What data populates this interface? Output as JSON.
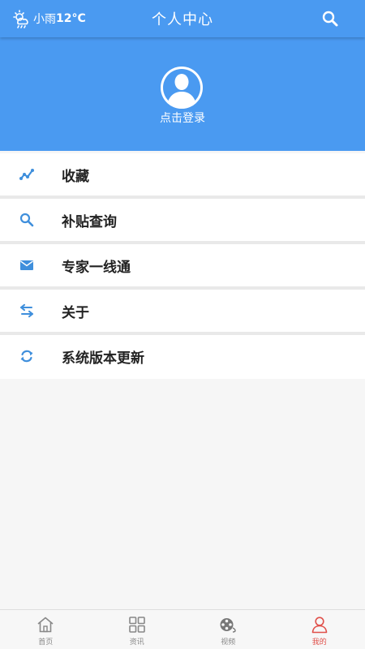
{
  "header": {
    "weather": {
      "condition": "小雨",
      "temperature": "12°C"
    },
    "title": "个人中心",
    "login_text": "点击登录"
  },
  "menu": {
    "items": [
      {
        "label": "收藏",
        "icon": "trend-icon"
      },
      {
        "label": "补贴查询",
        "icon": "search-icon"
      },
      {
        "label": "专家一线通",
        "icon": "mail-icon"
      },
      {
        "label": "关于",
        "icon": "swap-arrows-icon"
      },
      {
        "label": "系统版本更新",
        "icon": "refresh-icon"
      }
    ]
  },
  "tabbar": {
    "items": [
      {
        "label": "首页",
        "icon": "home-icon"
      },
      {
        "label": "资讯",
        "icon": "grid-icon"
      },
      {
        "label": "视频",
        "icon": "film-reel-icon"
      },
      {
        "label": "我的",
        "icon": "user-icon",
        "active": true
      }
    ]
  },
  "colors": {
    "primary": "#4a9af1",
    "icon_blue": "#3f8fdc",
    "active_tab": "#e0504a"
  }
}
